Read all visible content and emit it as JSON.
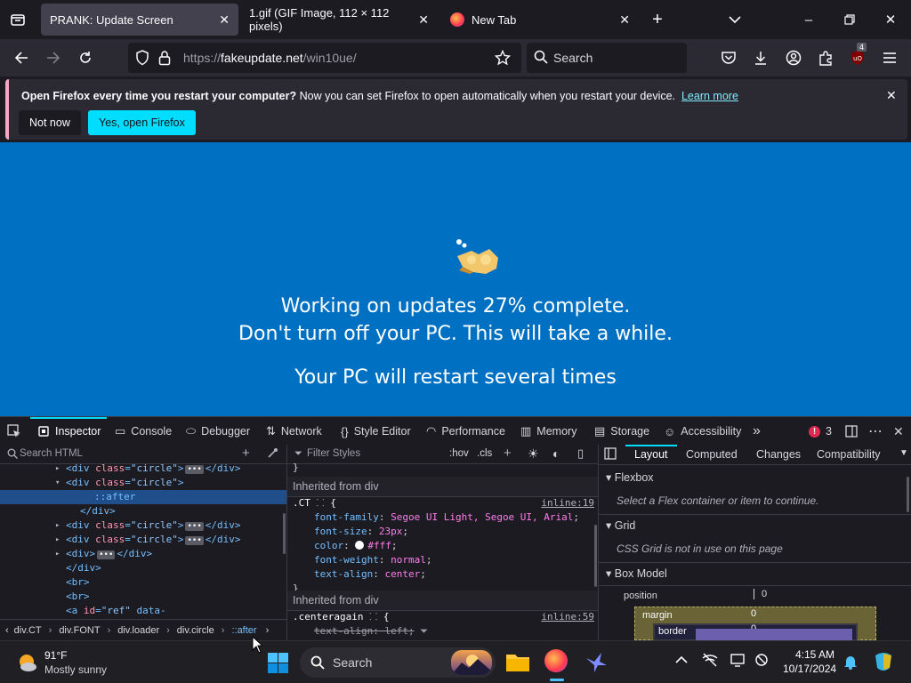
{
  "browser": {
    "tabs": [
      {
        "title": "PRANK: Update Screen",
        "selected": true
      },
      {
        "title": "1.gif (GIF Image, 112 × 112 pixels)",
        "selected": false
      },
      {
        "title": "New Tab",
        "selected": false
      }
    ],
    "url": {
      "protocol": "https://",
      "host": "fakeupdate.net",
      "path": "/win10ue/"
    },
    "search_placeholder": "Search",
    "extension_badge": "4"
  },
  "notification": {
    "bold": "Open Firefox every time you restart your computer?",
    "text": " Now you can set Firefox to open automatically when you restart your device.",
    "link": "Learn more",
    "btn_no": "Not now",
    "btn_yes": "Yes, open Firefox"
  },
  "page": {
    "line1": "Working on updates  27% complete.",
    "line2": "Don't turn off your PC. This will take a while.",
    "line3": "Your PC will restart several times"
  },
  "devtools": {
    "tabs": [
      "Inspector",
      "Console",
      "Debugger",
      "Network",
      "Style Editor",
      "Performance",
      "Memory",
      "Storage",
      "Accessibility"
    ],
    "error_count": "3",
    "search_html_placeholder": "Search HTML",
    "html_lines": [
      {
        "indent": 5,
        "arrow": "▸",
        "open": "<div ",
        "attr": "class",
        "val": "\"circle\"",
        "rest": ">",
        "dots": true,
        "close": "</div>"
      },
      {
        "indent": 5,
        "arrow": "▾",
        "open": "<div ",
        "attr": "class",
        "val": "\"circle\"",
        "rest": ">",
        "dots": false,
        "close": ""
      },
      {
        "indent": 9,
        "arrow": "",
        "open": "::after",
        "attr": "",
        "val": "",
        "rest": "",
        "dots": false,
        "close": "",
        "selected": true
      },
      {
        "indent": 7,
        "arrow": "",
        "open": "</div>",
        "attr": "",
        "val": "",
        "rest": "",
        "dots": false,
        "close": ""
      },
      {
        "indent": 5,
        "arrow": "▸",
        "open": "<div ",
        "attr": "class",
        "val": "\"circle\"",
        "rest": ">",
        "dots": true,
        "close": "</div>"
      },
      {
        "indent": 5,
        "arrow": "▸",
        "open": "<div ",
        "attr": "class",
        "val": "\"circle\"",
        "rest": ">",
        "dots": true,
        "close": "</div>"
      },
      {
        "indent": 5,
        "arrow": "▸",
        "open": "<div>",
        "attr": "",
        "val": "",
        "rest": "",
        "dots": true,
        "close": "</div>"
      },
      {
        "indent": 5,
        "arrow": "",
        "open": "</div>",
        "attr": "",
        "val": "",
        "rest": "",
        "dots": false,
        "close": ""
      },
      {
        "indent": 5,
        "arrow": "",
        "open": "<br>",
        "attr": "",
        "val": "",
        "rest": "",
        "dots": false,
        "close": ""
      },
      {
        "indent": 5,
        "arrow": "",
        "open": "<br>",
        "attr": "",
        "val": "",
        "rest": "",
        "dots": false,
        "close": ""
      },
      {
        "indent": 5,
        "arrow": "",
        "open": "<a ",
        "attr": "id",
        "val": "\"ref\"",
        "rest": " data-",
        "dots": false,
        "close": ""
      }
    ],
    "breadcrumbs": [
      "div.CT",
      "div.FONT",
      "div.loader",
      "div.circle",
      "::after"
    ],
    "filter_styles_placeholder": "Filter Styles",
    "hov": ":hov",
    "cls": ".cls",
    "inherited_label": "Inherited from div",
    "rule1": {
      "selector": ".CT",
      "source": "inline:19",
      "props": [
        {
          "name": "font-family",
          "value": "Segoe UI Light, Segoe UI, Arial"
        },
        {
          "name": "font-size",
          "value": "23px"
        },
        {
          "name": "color",
          "value": "#fff",
          "swatch": true
        },
        {
          "name": "font-weight",
          "value": "normal"
        },
        {
          "name": "text-align",
          "value": "center"
        }
      ]
    },
    "rule2": {
      "selector": ".centeragain",
      "source": "inline:59",
      "struck": "text-align: left;"
    },
    "layout_tabs": [
      "Layout",
      "Computed",
      "Changes",
      "Compatibility"
    ],
    "flexbox_label": "Flexbox",
    "flexbox_msg": "Select a Flex container or item to continue.",
    "grid_label": "Grid",
    "grid_msg": "CSS Grid is not in use on this page",
    "boxmodel_label": "Box Model",
    "position_label": "position",
    "position_val": "0",
    "margin_label": "margin",
    "margin_val": "0",
    "border_label": "border",
    "border_val": "0"
  },
  "taskbar": {
    "weather_temp": "91°F",
    "weather_desc": "Mostly sunny",
    "search": "Search",
    "time": "4:15 AM",
    "date": "10/17/2024"
  },
  "colors": {
    "update_blue": "#0071c2",
    "accent_cyan": "#00ddff",
    "yes_button": "#00ddff"
  }
}
